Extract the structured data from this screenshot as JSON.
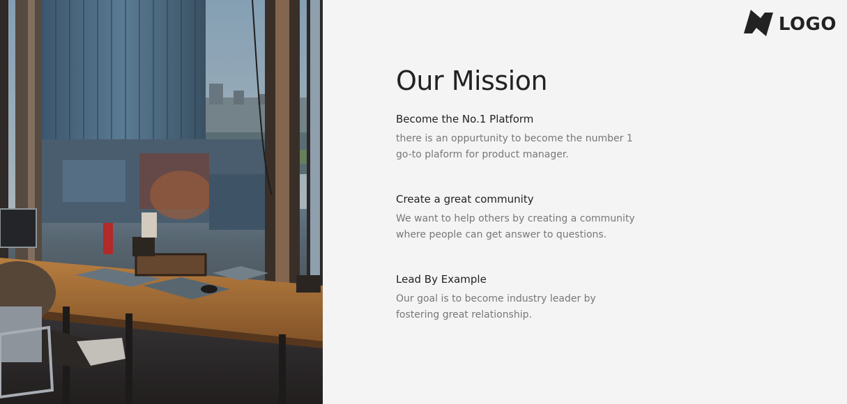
{
  "logo": {
    "icon": "logo-mark-icon",
    "text": "LOGO"
  },
  "photo": {
    "description_icon": "office-photo"
  },
  "mission": {
    "title": "Our Mission",
    "items": [
      {
        "heading": "Become the No.1 Platform",
        "description": "there is an oppurtunity to become the number 1 go-to plaform for product manager."
      },
      {
        "heading": "Create a great community",
        "description": "We want to help others by creating a community where people can get answer to questions."
      },
      {
        "heading": "Lead By Example",
        "description": "Our goal is to become industry leader by fostering great relationship."
      }
    ]
  },
  "colors": {
    "background": "#f4f4f4",
    "heading": "#222222",
    "body_text": "#777777"
  }
}
